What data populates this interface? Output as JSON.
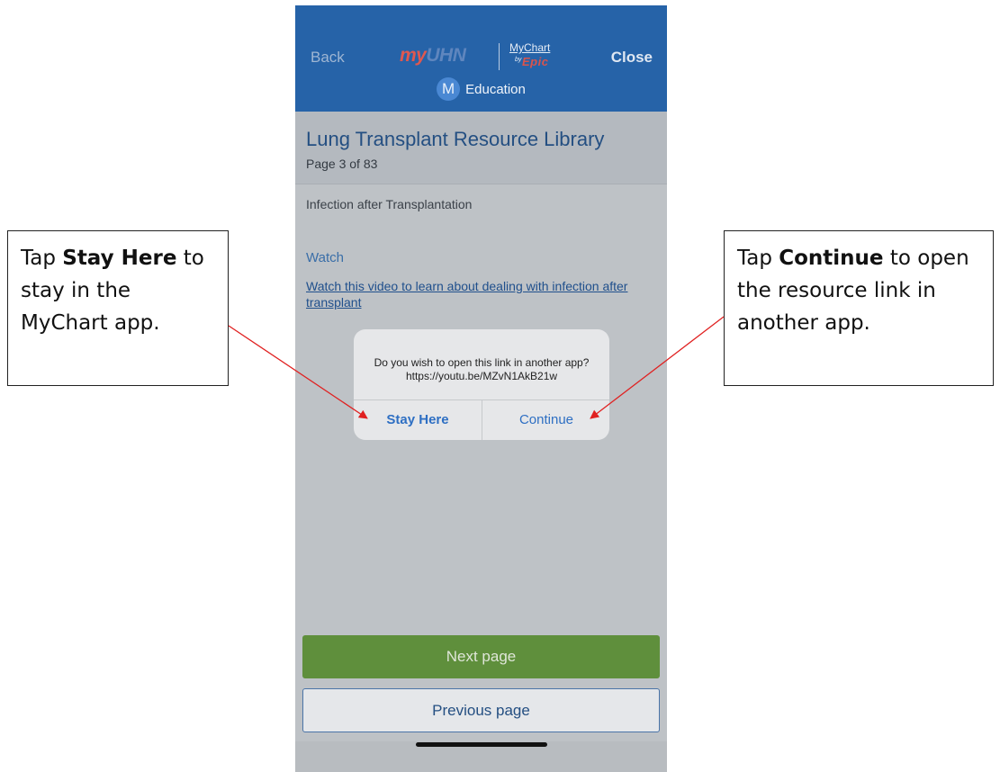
{
  "app": {
    "back_label": "Back",
    "close_label": "Close",
    "logo_my": "my",
    "logo_uhn": "UHN",
    "logo_mychart": "MyChart",
    "logo_by": "by",
    "logo_epic": "Epic",
    "section_icon_letter": "M",
    "section_label": "Education"
  },
  "library": {
    "title": "Lung Transplant Resource Library",
    "page_count": "Page 3 of 83"
  },
  "content": {
    "topic": "Infection after Transplantation",
    "watch_heading": "Watch",
    "watch_link": "Watch this video to learn about dealing with infection after transplant"
  },
  "dialog": {
    "message": "Do you wish to open this link in another app? https://youtu.be/MZvN1AkB21w",
    "stay_label": "Stay Here",
    "continue_label": "Continue"
  },
  "nav": {
    "next_label": "Next page",
    "previous_label": "Previous page"
  },
  "callouts": {
    "left_pre": "Tap ",
    "left_bold": "Stay Here",
    "left_post": " to stay in the MyChart app.",
    "right_pre": "Tap ",
    "right_bold": "Continue",
    "right_post": " to open the resource link in another app."
  },
  "colors": {
    "header_blue": "#2663a8",
    "next_green": "#5f8f3c",
    "arrow_red": "#e02020"
  }
}
